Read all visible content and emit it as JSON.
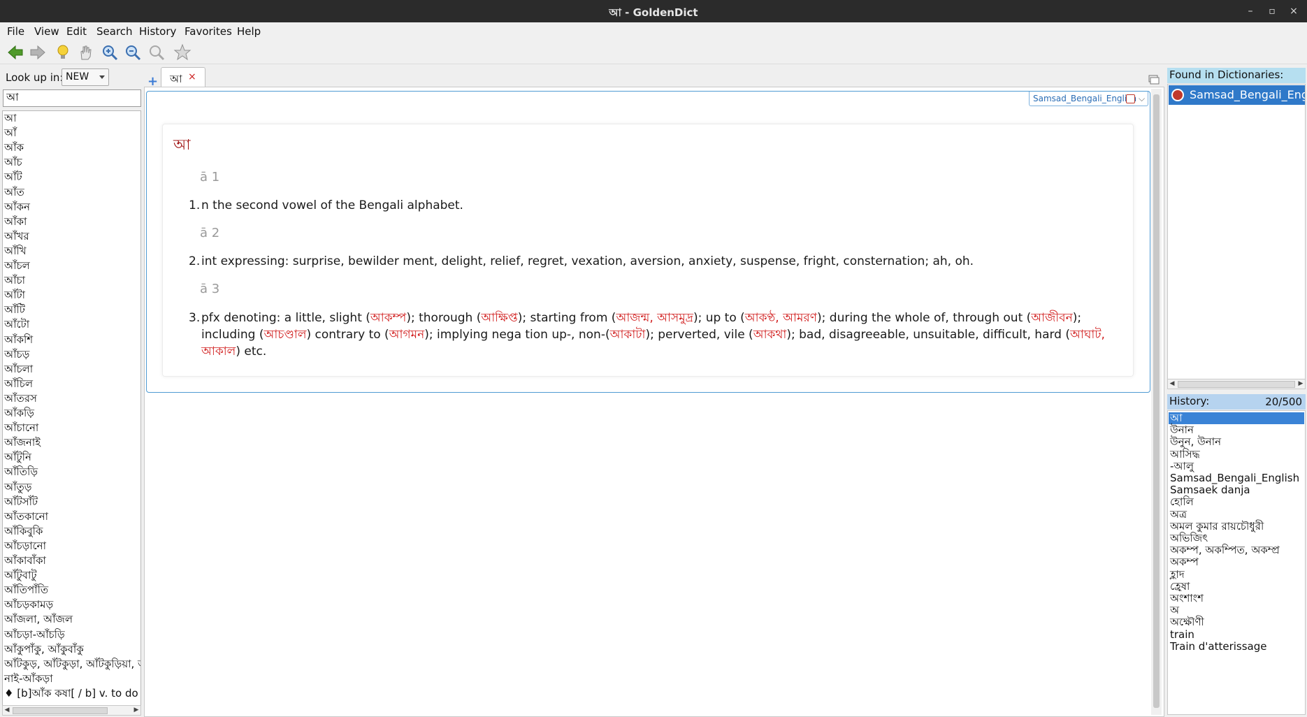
{
  "window": {
    "title": "আ - GoldenDict",
    "controls": [
      "–",
      "▫",
      "×"
    ]
  },
  "menu": [
    "File",
    "View",
    "Edit",
    "Search",
    "History",
    "Favorites",
    "Help"
  ],
  "toolbar": {
    "icons": [
      "back-arrow-icon",
      "forward-arrow-icon",
      "lightbulb-icon",
      "hand-icon",
      "zoom-in-icon",
      "zoom-out-icon",
      "zoom-reset-icon",
      "star-icon"
    ]
  },
  "left": {
    "lookup_label": "Look up in:",
    "group": "NEW",
    "input_value": "আ",
    "words": [
      "আ",
      "আঁ",
      "আঁক",
      "আঁচ",
      "আঁট",
      "আঁত",
      "আঁকন",
      "আঁকা",
      "আঁখর",
      "আঁখি",
      "আঁচল",
      "আঁচা",
      "আঁটা",
      "আঁটি",
      "আঁটো",
      "আঁকশি",
      "আঁচড়",
      "আঁচলা",
      "আঁচিল",
      "আঁতরস",
      "আঁকড়ি",
      "আঁচানো",
      "আঁজনাই",
      "আঁটুনি",
      "আঁতিড়ি",
      "আঁতুড়",
      "আঁটসাঁট",
      "আঁতকানো",
      "আঁকিবুকি",
      "আঁচড়ানো",
      "আঁকাবাঁকা",
      "আঁটুবাটু",
      "আঁতিপাঁতি",
      "আঁচড়কামড়",
      "আঁজলা, আঁজল",
      "আঁচড়া-আঁচড়ি",
      "আঁকুপাঁকু, আঁকুবাঁকু",
      "আঁটকুড়, আঁটকুড়া, আঁটকুড়িয়া, আঁ",
      "নাই-আঁকড়া",
      "♦ [b]আঁক কষা[ / b] v. to do a s"
    ]
  },
  "tab": {
    "label": "আ",
    "close": "×"
  },
  "article": {
    "dict_badge": "Samsad_Bengali_English",
    "headword": "আ",
    "senses": [
      {
        "label": "ā 1",
        "num": "1.",
        "parts": [
          {
            "t": "n the second vowel of the Bengali alphabet.",
            "red": false
          }
        ]
      },
      {
        "label": "ā 2",
        "num": "2.",
        "parts": [
          {
            "t": "int expressing: surprise, bewilder ment, delight, relief, regret, vexation, aversion, anxiety, suspense, fright, consternation; ah, oh.",
            "red": false
          }
        ]
      },
      {
        "label": "ā 3",
        "num": "3.",
        "parts": [
          {
            "t": "pfx denoting: a little, slight (",
            "red": false
          },
          {
            "t": "আকম্প",
            "red": true
          },
          {
            "t": "); thorough (",
            "red": false
          },
          {
            "t": "আক্ষিপ্ত",
            "red": true
          },
          {
            "t": "); starting from (",
            "red": false
          },
          {
            "t": "আজন্ম, আসমুদ্র",
            "red": true
          },
          {
            "t": "); up to (",
            "red": false
          },
          {
            "t": "আকণ্ঠ, আমরণ",
            "red": true
          },
          {
            "t": "); during the whole of, through out (",
            "red": false
          },
          {
            "t": "আজীবন",
            "red": true
          },
          {
            "t": "); including (",
            "red": false
          },
          {
            "t": "আচণ্ডাল",
            "red": true
          },
          {
            "t": ") contrary to (",
            "red": false
          },
          {
            "t": "আগমন",
            "red": true
          },
          {
            "t": "); implying nega tion up-, non-(",
            "red": false
          },
          {
            "t": "আকাটা",
            "red": true
          },
          {
            "t": "); perverted, vile (",
            "red": false
          },
          {
            "t": "আকথা",
            "red": true
          },
          {
            "t": "); bad, disagreeable, unsuitable, difficult, hard (",
            "red": false
          },
          {
            "t": "আঘাট, আকাল",
            "red": true
          },
          {
            "t": ") etc.",
            "red": false
          }
        ]
      }
    ]
  },
  "right": {
    "found_label": "Found in Dictionaries:",
    "found": [
      "Samsad_Bengali_English"
    ],
    "history_label": "History:",
    "history_count": "20/500",
    "history": [
      "আ",
      "উনান",
      "উনুন, উনান",
      "আসিদ্ধ",
      "-আলু",
      "Samsad_Bengali_English",
      "Samsaek danja",
      "হোলি",
      "অত্র",
      "অমল কুমার রায়চৌধুরী",
      "অভিজিৎ",
      "অকম্প, অকম্পিত, অকম্প্র",
      "অকম্প",
      "হ্লাদ",
      "হ্রেষা",
      "অংশাংশ",
      "অ",
      "অক্ষৌণী",
      "train",
      "Train d'atterissage"
    ]
  },
  "colors": {
    "accent": "#2f79c9",
    "link_red": "#d11d1d",
    "headword": "#a01414",
    "titlebar": "#2b2b2b"
  }
}
